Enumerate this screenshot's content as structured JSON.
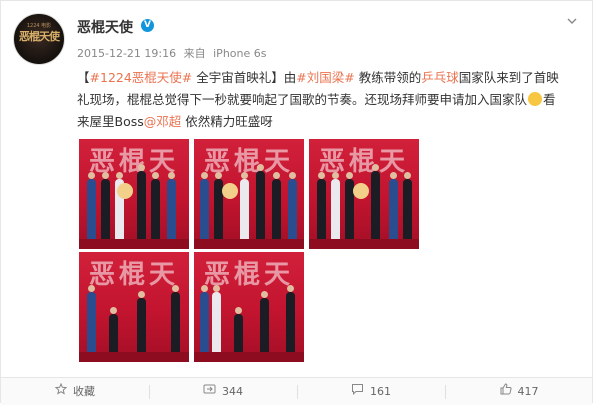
{
  "post": {
    "username": "恶棍天使",
    "verified_mark": "V",
    "timestamp": "2015-12-21 19:16",
    "source_prefix": "来自",
    "source": "iPhone 6s",
    "text": {
      "bracket_open": "【",
      "topic1": "#1224恶棍天使#",
      "part1": " 全宇宙首映礼】由",
      "topic2": "#刘国梁#",
      "part2": " 教练带领的",
      "link1": "乒乓球",
      "part3": "国家队来到了首映礼现场，棍棍总觉得下一秒就要响起了国歌的节奏。还现场拜师要申请加入国家队",
      "part4": "看来屋里Boss",
      "mention": "@邓超",
      "part5": " 依然精力旺盛呀"
    }
  },
  "avatar": {
    "logo_text": "恶棍天使",
    "logo_sub": "1224 电影"
  },
  "photos": {
    "banner_text": "恶棍天"
  },
  "footer": {
    "favorite_label": "收藏",
    "repost_count": "344",
    "comment_count": "161",
    "like_count": "417"
  },
  "colors": {
    "accent": "#eb7350",
    "verified": "#1296db",
    "backdrop_red": "#c2142f"
  }
}
